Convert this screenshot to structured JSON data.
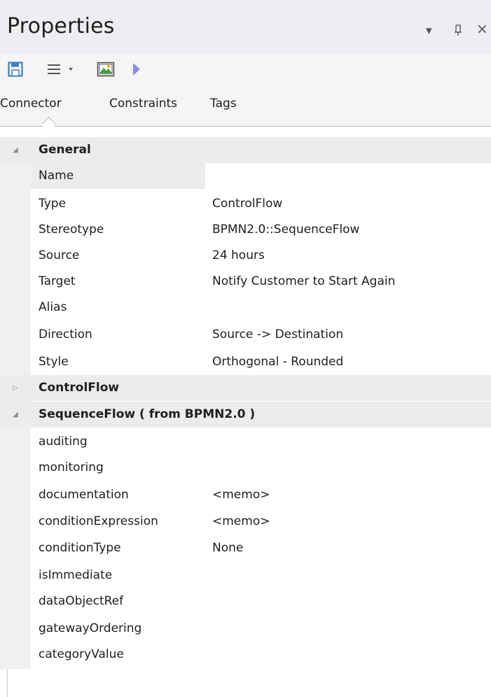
{
  "window": {
    "title": "Properties",
    "dropdown_glyph": "▾",
    "pin_glyph": "ᵽ",
    "close_glyph": "×"
  },
  "toolbar": {
    "icons": [
      "save-icon",
      "list-menu-icon",
      "dropdown-arrow-icon",
      "image-icon",
      "play-icon"
    ]
  },
  "tabs": [
    {
      "label": "Connector",
      "active": true
    },
    {
      "label": "Constraints",
      "active": false
    },
    {
      "label": "Tags",
      "active": false
    }
  ],
  "groups": {
    "general": {
      "title": "General",
      "expanded": true,
      "rows": [
        {
          "name": "Name",
          "value": ""
        },
        {
          "name": "Type",
          "value": "ControlFlow"
        },
        {
          "name": "Stereotype",
          "value": "BPMN2.0::SequenceFlow"
        },
        {
          "name": "Source",
          "value": "24 hours"
        },
        {
          "name": "Target",
          "value": "Notify Customer to Start Again"
        },
        {
          "name": "Alias",
          "value": ""
        },
        {
          "name": "Direction",
          "value": "Source -> Destination"
        },
        {
          "name": "Style",
          "value": "Orthogonal - Rounded"
        }
      ]
    },
    "controlflow": {
      "title": "ControlFlow",
      "expanded": false
    },
    "sequenceflow": {
      "title": "SequenceFlow  ( from BPMN2.0 )",
      "expanded": true,
      "rows": [
        {
          "name": "auditing",
          "value": ""
        },
        {
          "name": "monitoring",
          "value": ""
        },
        {
          "name": "documentation",
          "value": "<memo>"
        },
        {
          "name": "conditionExpression",
          "value": "<memo>"
        },
        {
          "name": "conditionType",
          "value": "None"
        },
        {
          "name": "isImmediate",
          "value": ""
        },
        {
          "name": "dataObjectRef",
          "value": ""
        },
        {
          "name": "gatewayOrdering",
          "value": ""
        },
        {
          "name": "categoryValue",
          "value": ""
        }
      ]
    }
  },
  "colors": {
    "title_bg": "#eeeef2",
    "group_bg": "#ececec",
    "save_icon": "#3b7fc4",
    "play_icon": "#8a8ee8"
  }
}
